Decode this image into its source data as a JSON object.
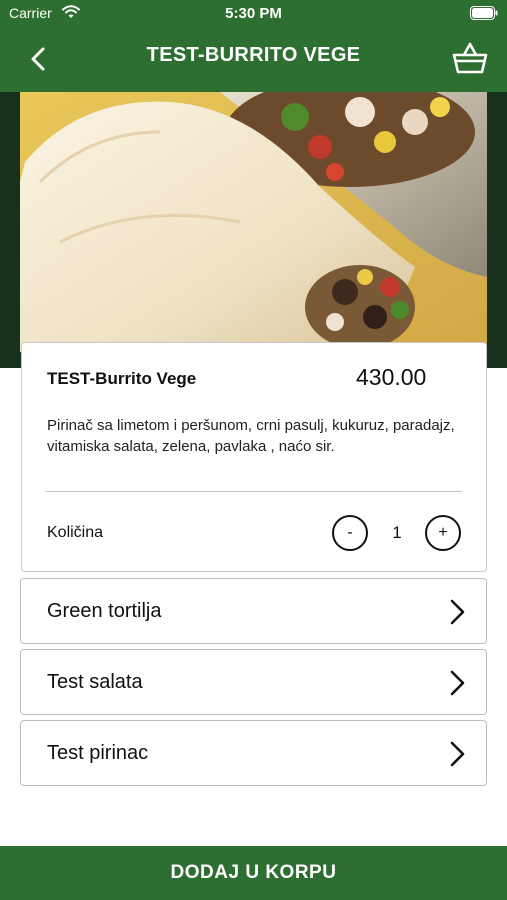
{
  "status_bar": {
    "carrier": "Carrier",
    "time": "5:30 PM",
    "icons": [
      "wifi-icon",
      "battery-icon"
    ]
  },
  "header": {
    "title": "TEST-BURRITO VEGE",
    "back_icon": "chevron-left-icon",
    "cart_icon": "basket-icon",
    "background_color": "#2d6e31"
  },
  "product": {
    "image_description_icon": "burrito-photo",
    "name": "TEST-Burrito Vege",
    "price": "430.00",
    "description": "Pirinač sa limetom i peršunom, crni pasulj, kukuruz, paradajz, vitamiska salata, zelena, pavlaka , naćo sir.",
    "quantity_label": "Količina",
    "quantity": "1",
    "decrease_label": "-",
    "increase_label": "+"
  },
  "options": [
    {
      "label": "Green tortilja"
    },
    {
      "label": "Test salata"
    },
    {
      "label": "Test pirinac"
    }
  ],
  "footer": {
    "add_to_cart_label": "DODAJ U KORPU"
  },
  "colors": {
    "brand_green": "#2d6e31",
    "hero_dark": "#17311c",
    "text": "#111111"
  }
}
